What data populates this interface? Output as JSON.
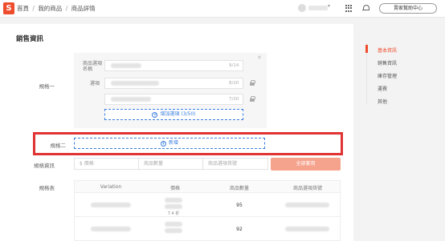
{
  "header": {
    "logo_text": "S",
    "breadcrumbs": [
      "首頁",
      "我的商品",
      "商品詳情"
    ],
    "separator": "/",
    "help_button": "賣家幫助中心"
  },
  "section": {
    "title": "銷售資訊"
  },
  "variation1": {
    "label": "規格一",
    "name_label": "商品選項名稱",
    "name_count": "9/14",
    "options_label": "選項",
    "option_counts": [
      "8/20",
      "7/20"
    ],
    "add_option": "增加選項 (3/50)"
  },
  "variation2": {
    "label": "規格二",
    "new_button": "新增"
  },
  "spec": {
    "label": "規格資訊",
    "price_placeholder": "$ 價格",
    "stock_placeholder": "商品數量",
    "sku_placeholder": "商品選項貨號",
    "apply_button": "全部套用"
  },
  "table": {
    "label": "規格表",
    "headers": [
      "Variation",
      "價格",
      "商品數量",
      "商品選項貨號"
    ],
    "rows": [
      {
        "stock": "95",
        "price_note": "7.4 折"
      },
      {
        "stock": "92",
        "price_note": ""
      }
    ]
  },
  "sidenav": {
    "items": [
      "基本資訊",
      "銷售資訊",
      "運費",
      "其他"
    ],
    "active": "基本資訊",
    "items_full": [
      "基本資訊",
      "銷售資訊",
      "庫存管理",
      "運費",
      "其他"
    ]
  },
  "colors": {
    "brand": "#ee4d2d",
    "link": "#3b7ddd",
    "highlight": "#e03333"
  }
}
